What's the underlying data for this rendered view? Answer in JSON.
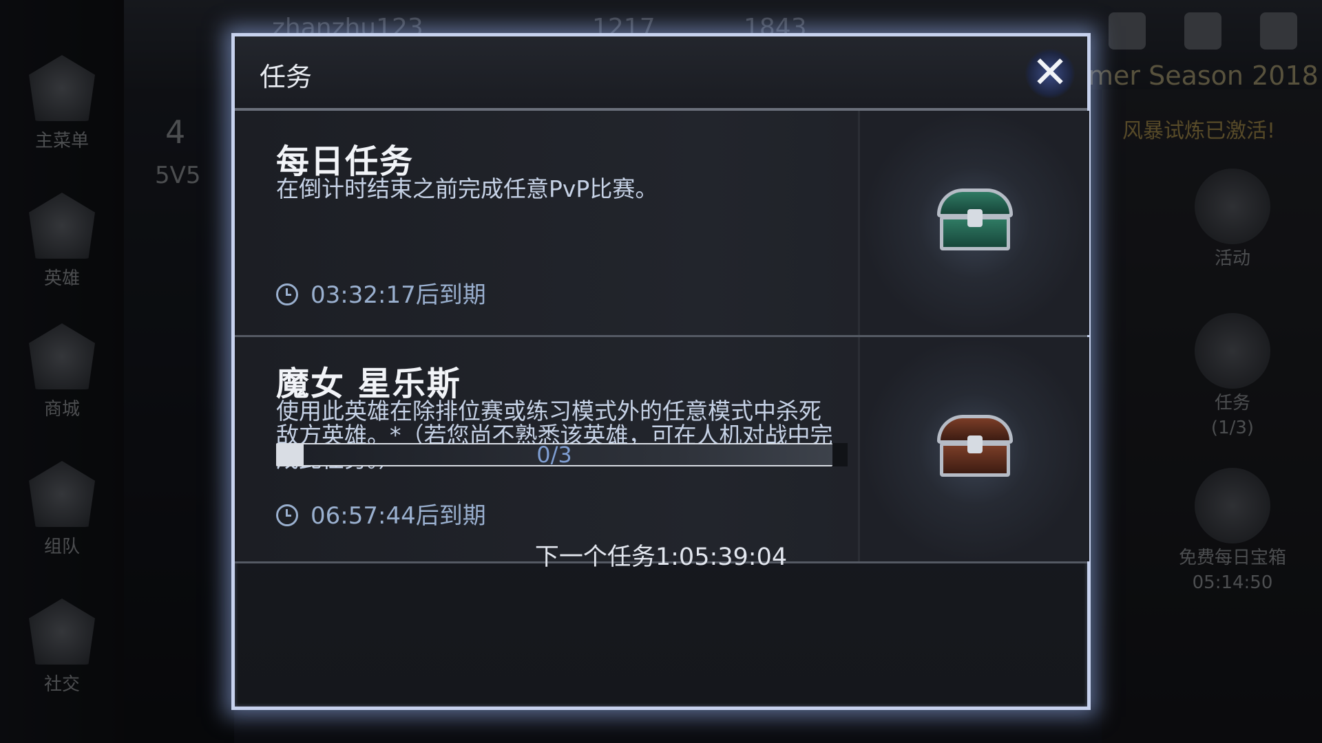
{
  "background": {
    "username": "zhanzhu123",
    "currency_1": "1217",
    "currency_2": "1843",
    "rank_level": "4",
    "rank_mode": "5V5",
    "season_title": "mer Season 2018",
    "season_notice": "风暴试炼已激活!",
    "sidebar": [
      {
        "label": "主菜单"
      },
      {
        "label": "英雄"
      },
      {
        "label": "商城"
      },
      {
        "label": "组队"
      },
      {
        "label": "社交"
      }
    ],
    "right_panel": {
      "events_label": "活动",
      "quests_label": "任务",
      "quests_count": "(1/3)",
      "daily_chest_label": "免费每日宝箱",
      "daily_chest_timer": "05:14:50"
    }
  },
  "modal": {
    "title": "任务",
    "close_icon": "close-icon",
    "quests": [
      {
        "title": "每日任务",
        "description": "在倒计时结束之前完成任意PvP比赛。",
        "timer": "03:32:17后到期",
        "reward_icon": "green-chest-icon"
      },
      {
        "title": "魔女 星乐斯",
        "description": "使用此英雄在除排位赛或练习模式外的任意模式中杀死敌方英雄。*（若您尚不熟悉该英雄，可在人机对战中完成此任务。）",
        "progress_text": "0/3",
        "progress_value": 0,
        "progress_max": 3,
        "timer": "06:57:44后到期",
        "reward_icon": "brown-chest-icon"
      }
    ],
    "next_quest": "下一个任务1:05:39:04"
  }
}
